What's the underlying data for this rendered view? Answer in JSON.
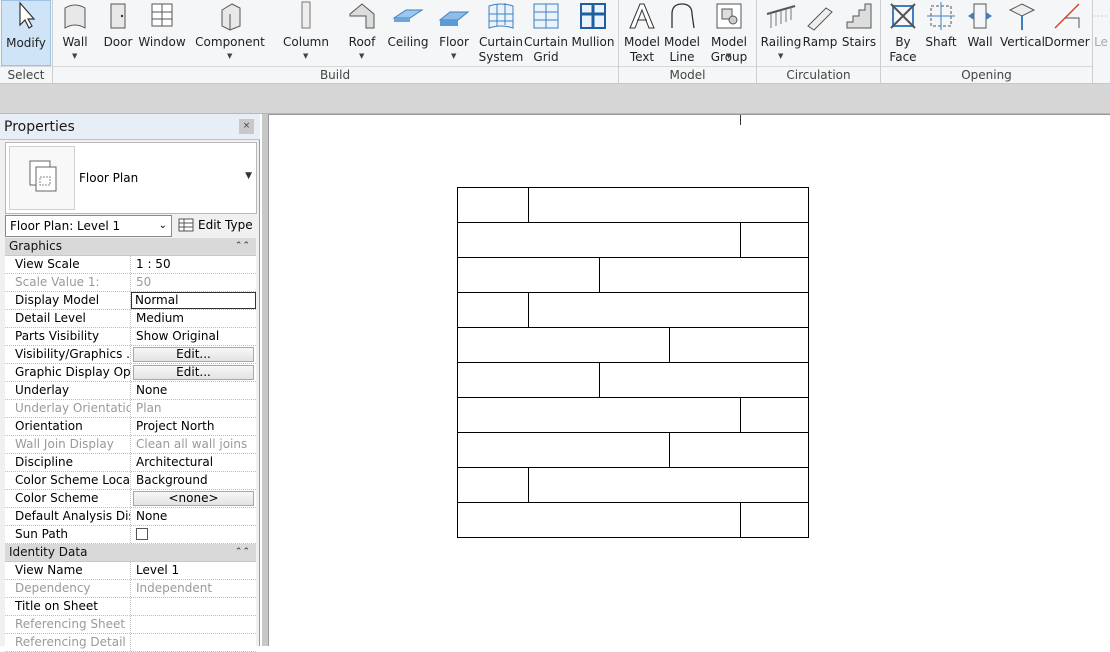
{
  "ribbon": {
    "tools": [
      {
        "id": "modify",
        "label": "Modify",
        "icon": "cursor-arrow-icon",
        "dropdown": false
      },
      {
        "id": "wall",
        "label": "Wall",
        "icon": "wall-icon",
        "dropdown": true
      },
      {
        "id": "door",
        "label": "Door",
        "icon": "door-icon",
        "dropdown": false
      },
      {
        "id": "window",
        "label": "Window",
        "icon": "window-icon",
        "dropdown": false
      },
      {
        "id": "component",
        "label": "Component",
        "icon": "component-icon",
        "dropdown": true
      },
      {
        "id": "column",
        "label": "Column",
        "icon": "column-icon",
        "dropdown": true
      },
      {
        "id": "roof",
        "label": "Roof",
        "icon": "roof-icon",
        "dropdown": true
      },
      {
        "id": "ceiling",
        "label": "Ceiling",
        "icon": "ceiling-icon",
        "dropdown": false
      },
      {
        "id": "floor",
        "label": "Floor",
        "icon": "floor-icon",
        "dropdown": true
      },
      {
        "id": "curtain_system",
        "label": "Curtain\nSystem",
        "icon": "curtain-system-icon",
        "dropdown": false
      },
      {
        "id": "curtain_grid",
        "label": "Curtain\nGrid",
        "icon": "curtain-grid-icon",
        "dropdown": false
      },
      {
        "id": "mullion",
        "label": "Mullion",
        "icon": "mullion-icon",
        "dropdown": false
      },
      {
        "id": "model_text",
        "label": "Model\nText",
        "icon": "model-text-icon",
        "dropdown": false
      },
      {
        "id": "model_line",
        "label": "Model\nLine",
        "icon": "model-line-icon",
        "dropdown": false
      },
      {
        "id": "model_group",
        "label": "Model\nGroup",
        "icon": "model-group-icon",
        "dropdown": true
      },
      {
        "id": "railing",
        "label": "Railing",
        "icon": "railing-icon",
        "dropdown": true
      },
      {
        "id": "ramp",
        "label": "Ramp",
        "icon": "ramp-icon",
        "dropdown": false
      },
      {
        "id": "stairs",
        "label": "Stairs",
        "icon": "stairs-icon",
        "dropdown": false
      },
      {
        "id": "by_face",
        "label": "By\nFace",
        "icon": "by-face-icon",
        "dropdown": false
      },
      {
        "id": "shaft",
        "label": "Shaft",
        "icon": "shaft-icon",
        "dropdown": false
      },
      {
        "id": "wall_opening",
        "label": "Wall",
        "icon": "wall-opening-icon",
        "dropdown": false
      },
      {
        "id": "vertical",
        "label": "Vertical",
        "icon": "vertical-opening-icon",
        "dropdown": false
      },
      {
        "id": "dormer",
        "label": "Dormer",
        "icon": "dormer-icon",
        "dropdown": false
      },
      {
        "id": "level_partial",
        "label": "Le",
        "icon": "level-icon",
        "dropdown": false
      }
    ],
    "panels": [
      "Select",
      "Build",
      "Model",
      "Circulation",
      "Opening"
    ],
    "accent": "#cfe4f6"
  },
  "properties": {
    "title": "Properties",
    "close": "×",
    "type_name": "Floor Plan",
    "instance_selector": "Floor Plan: Level 1",
    "edit_type": "Edit Type",
    "sections": [
      {
        "name": "Graphics",
        "toggle": "⌃⌃",
        "rows": [
          {
            "name": "View Scale",
            "value": "1 : 50",
            "disabled": false
          },
          {
            "name": "Scale Value    1:",
            "value": "50",
            "disabled": true
          },
          {
            "name": "Display Model",
            "value": "Normal",
            "disabled": false,
            "boxed": true
          },
          {
            "name": "Detail Level",
            "value": "Medium",
            "disabled": false
          },
          {
            "name": "Parts Visibility",
            "value": "Show Original",
            "disabled": false
          },
          {
            "name": "Visibility/Graphics ...",
            "value": "Edit...",
            "disabled": false,
            "button": true
          },
          {
            "name": "Graphic Display Opt...",
            "value": "Edit...",
            "disabled": false,
            "button": true
          },
          {
            "name": "Underlay",
            "value": "None",
            "disabled": false
          },
          {
            "name": "Underlay Orientation",
            "value": "Plan",
            "disabled": true
          },
          {
            "name": "Orientation",
            "value": "Project North",
            "disabled": false
          },
          {
            "name": "Wall Join Display",
            "value": "Clean all wall joins",
            "disabled": true
          },
          {
            "name": "Discipline",
            "value": "Architectural",
            "disabled": false
          },
          {
            "name": "Color Scheme Loca...",
            "value": "Background",
            "disabled": false
          },
          {
            "name": "Color Scheme",
            "value": "<none>",
            "disabled": false,
            "button": true
          },
          {
            "name": "Default Analysis Dis...",
            "value": "None",
            "disabled": false
          },
          {
            "name": "Sun Path",
            "value": "",
            "disabled": false,
            "checkbox": true
          }
        ]
      },
      {
        "name": "Identity Data",
        "toggle": "⌃⌃",
        "rows": [
          {
            "name": "View Name",
            "value": "Level 1",
            "disabled": false
          },
          {
            "name": "Dependency",
            "value": "Independent",
            "disabled": true
          },
          {
            "name": "Title on Sheet",
            "value": "",
            "disabled": false
          },
          {
            "name": "Referencing Sheet",
            "value": "",
            "disabled": true
          },
          {
            "name": "Referencing Detail",
            "value": "",
            "disabled": true
          }
        ]
      }
    ]
  },
  "plan": {
    "courses": [
      {
        "joint_fraction": 0.2
      },
      {
        "joint_fraction": 0.8
      },
      {
        "joint_fraction": 0.4
      },
      {
        "joint_fraction": 0.2
      },
      {
        "joint_fraction": 0.6
      },
      {
        "joint_fraction": 0.4
      },
      {
        "joint_fraction": 0.8
      },
      {
        "joint_fraction": 0.6
      },
      {
        "joint_fraction": 0.2
      },
      {
        "joint_fraction": 0.8
      }
    ]
  }
}
